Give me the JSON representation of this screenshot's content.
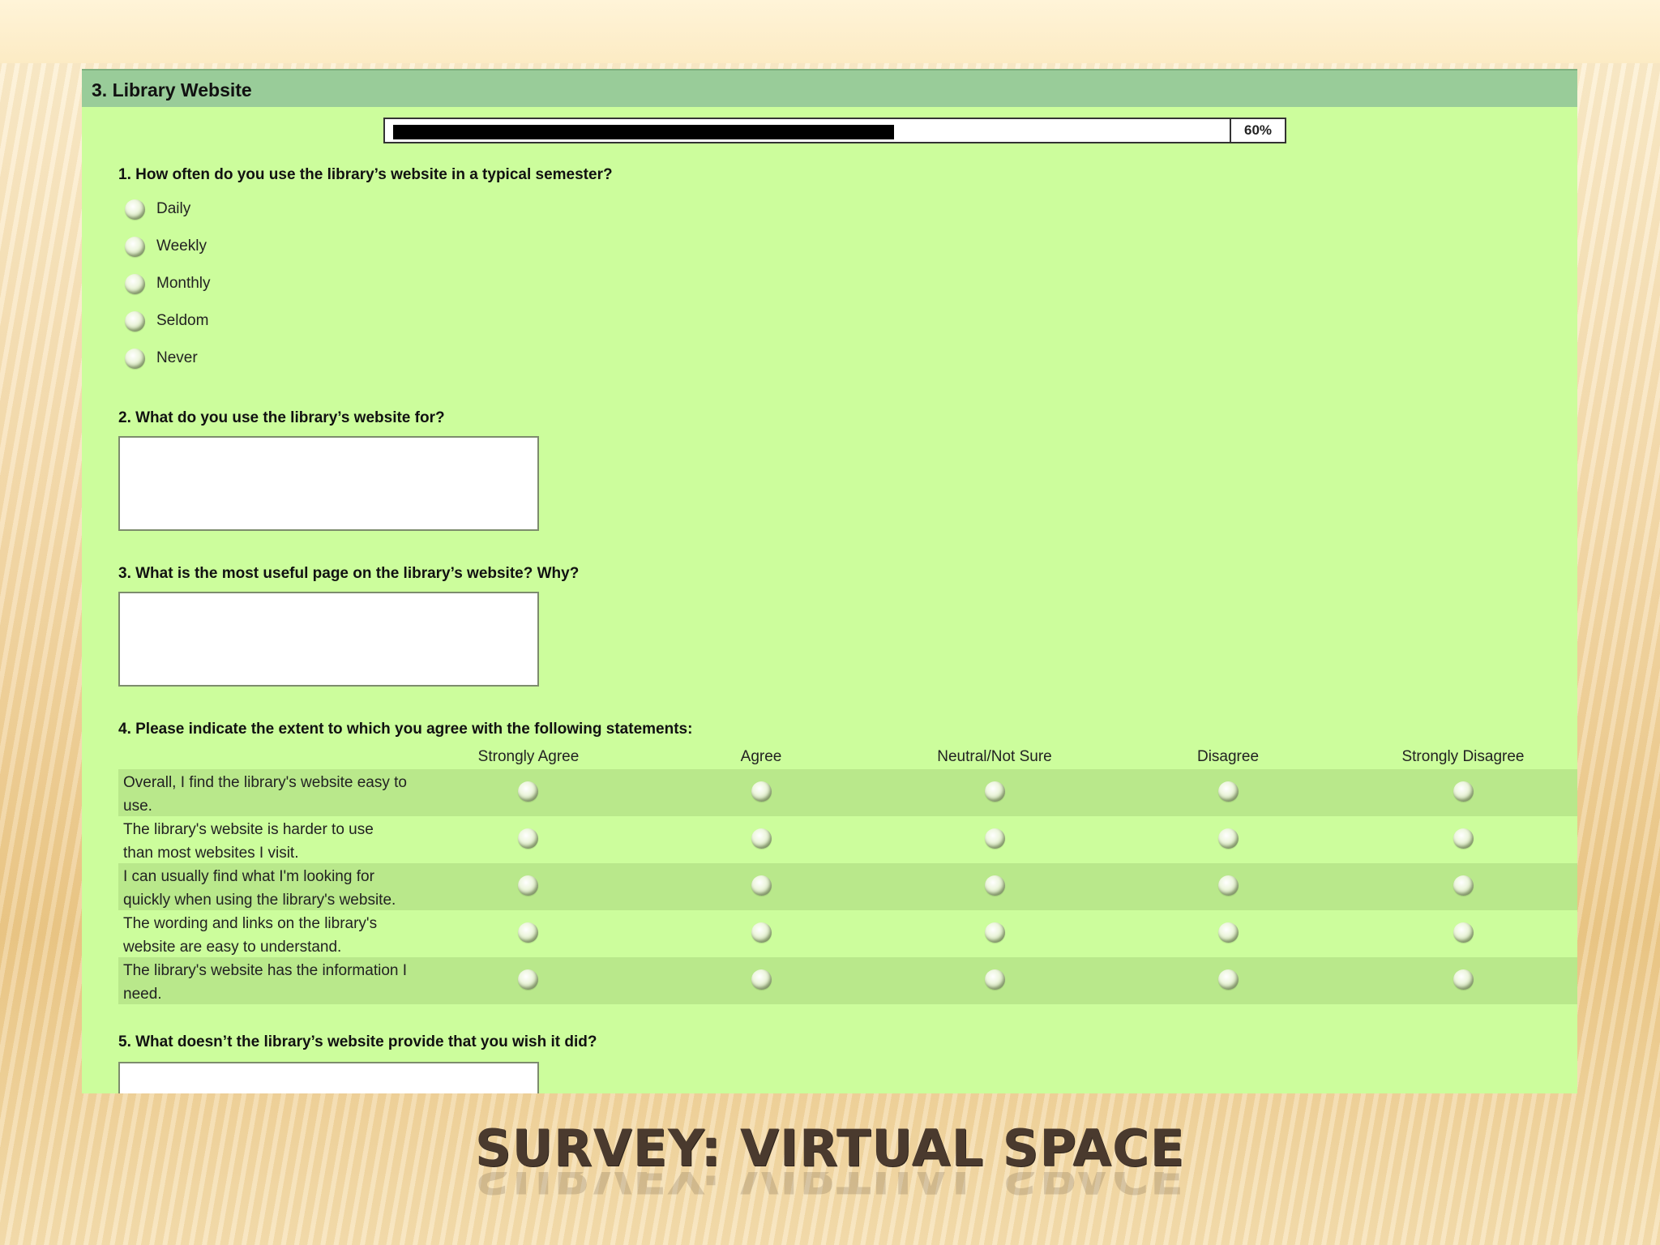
{
  "section": {
    "title": "3. Library Website"
  },
  "progress": {
    "percent": 60,
    "label": "60%"
  },
  "q1": {
    "text": "1. How often do you use the library’s website in a typical semester?",
    "options": [
      "Daily",
      "Weekly",
      "Monthly",
      "Seldom",
      "Never"
    ]
  },
  "q2": {
    "text": "2. What do you use the library’s website for?"
  },
  "q3": {
    "text": "3. What is the most useful page on the library’s website? Why?"
  },
  "q4": {
    "text": "4. Please indicate the extent to which you agree with the following statements:",
    "columns": [
      "Strongly Agree",
      "Agree",
      "Neutral/Not Sure",
      "Disagree",
      "Strongly Disagree"
    ],
    "rows": [
      {
        "line1": "Overall, I find the library's website easy to",
        "line2": "use."
      },
      {
        "line1": "The library's website is harder to use",
        "line2": "than most websites I visit."
      },
      {
        "line1": "I can usually find what I'm looking for",
        "line2": "quickly when using the library's website."
      },
      {
        "line1": "The wording and links on the library's",
        "line2": "website are easy to understand."
      },
      {
        "line1": "The library's website has the information I",
        "line2": "need."
      }
    ]
  },
  "q5": {
    "text": "5. What doesn’t the library’s website provide that you wish it did?"
  },
  "slide": {
    "title": "SURVEY: VIRTUAL SPACE"
  },
  "colors": {
    "panel": "#ccfd9c",
    "header": "#99cc99",
    "row_alt": "#b9e88b",
    "title": "#4a3a2e"
  }
}
